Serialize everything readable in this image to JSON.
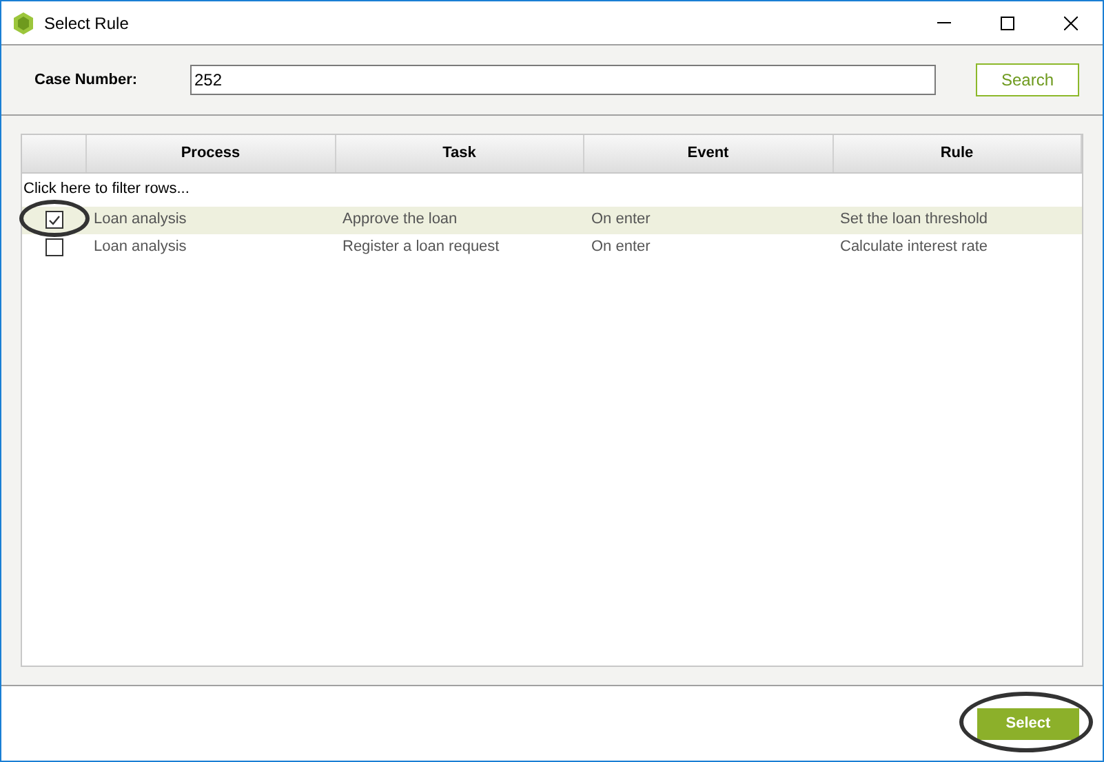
{
  "window": {
    "title": "Select Rule"
  },
  "search": {
    "label": "Case Number:",
    "value": "252",
    "button": "Search"
  },
  "table": {
    "columns": [
      "Process",
      "Task",
      "Event",
      "Rule"
    ],
    "filter_hint": "Click here to filter rows...",
    "rows": [
      {
        "checked": true,
        "selected": true,
        "cells": [
          "Loan analysis",
          "Approve the loan",
          "On enter",
          "Set the loan threshold"
        ]
      },
      {
        "checked": false,
        "selected": false,
        "cells": [
          "Loan analysis",
          "Register a loan request",
          "On enter",
          "Calculate interest rate"
        ]
      }
    ]
  },
  "footer": {
    "button": "Select"
  }
}
